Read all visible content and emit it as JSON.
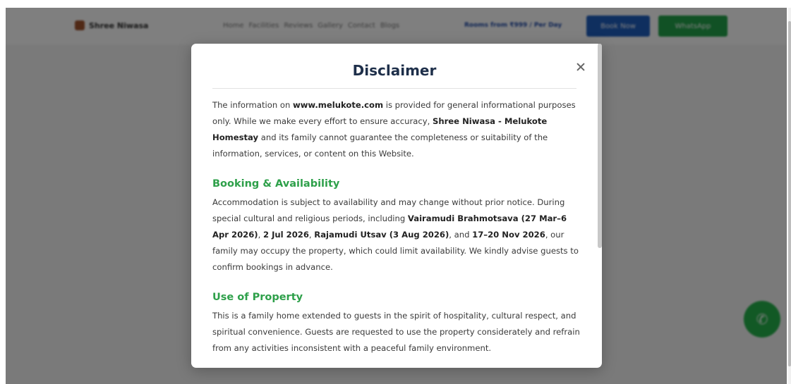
{
  "site": {
    "brand": "Shree Niwasa",
    "nav": [
      "Home",
      "Facilities",
      "Reviews",
      "Gallery",
      "Contact",
      "Blogs"
    ],
    "review_link": "Rooms from ₹999 / Per Day",
    "book_button": "Book Now",
    "whatsapp_button": "WhatsApp"
  },
  "modal": {
    "title": "Disclaimer",
    "intro": {
      "t1": "The information on ",
      "b1": "www.melukote.com",
      "t2": " is provided for general informational purposes only. While we make every effort to ensure accuracy, ",
      "b2": "Shree Niwasa - Melukote Homestay",
      "t3": " and its family cannot guarantee the completeness or suitability of the information, services, or content on this Website."
    },
    "booking": {
      "heading": "Booking & Availability",
      "t1": "Accommodation is subject to availability and may change without prior notice. During special cultural and religious periods, including ",
      "b1": "Vairamudi Brahmotsava (27 Mar–6 Apr 2026)",
      "t2": ", ",
      "b2": "2 Jul 2026",
      "t3": ", ",
      "b3": "Rajamudi Utsav (3 Aug 2026)",
      "t4": ", and ",
      "b4": "17–20 Nov 2026",
      "t5": ", our family may occupy the property, which could limit availability. We kindly advise guests to confirm bookings in advance."
    },
    "use": {
      "heading": "Use of Property",
      "text": "This is a family home extended to guests in the spirit of hospitality, cultural respect, and spiritual convenience. Guests are requested to use the property considerately and refrain from any activities inconsistent with a peaceful family environment."
    }
  },
  "icons": {
    "close": "close-icon",
    "fab": "whatsapp-icon"
  },
  "colors": {
    "heading_green": "#2ea04a",
    "title_navy": "#1e2f4a",
    "book_blue": "#1f5fbf",
    "whatsapp_green": "#22a34a"
  }
}
